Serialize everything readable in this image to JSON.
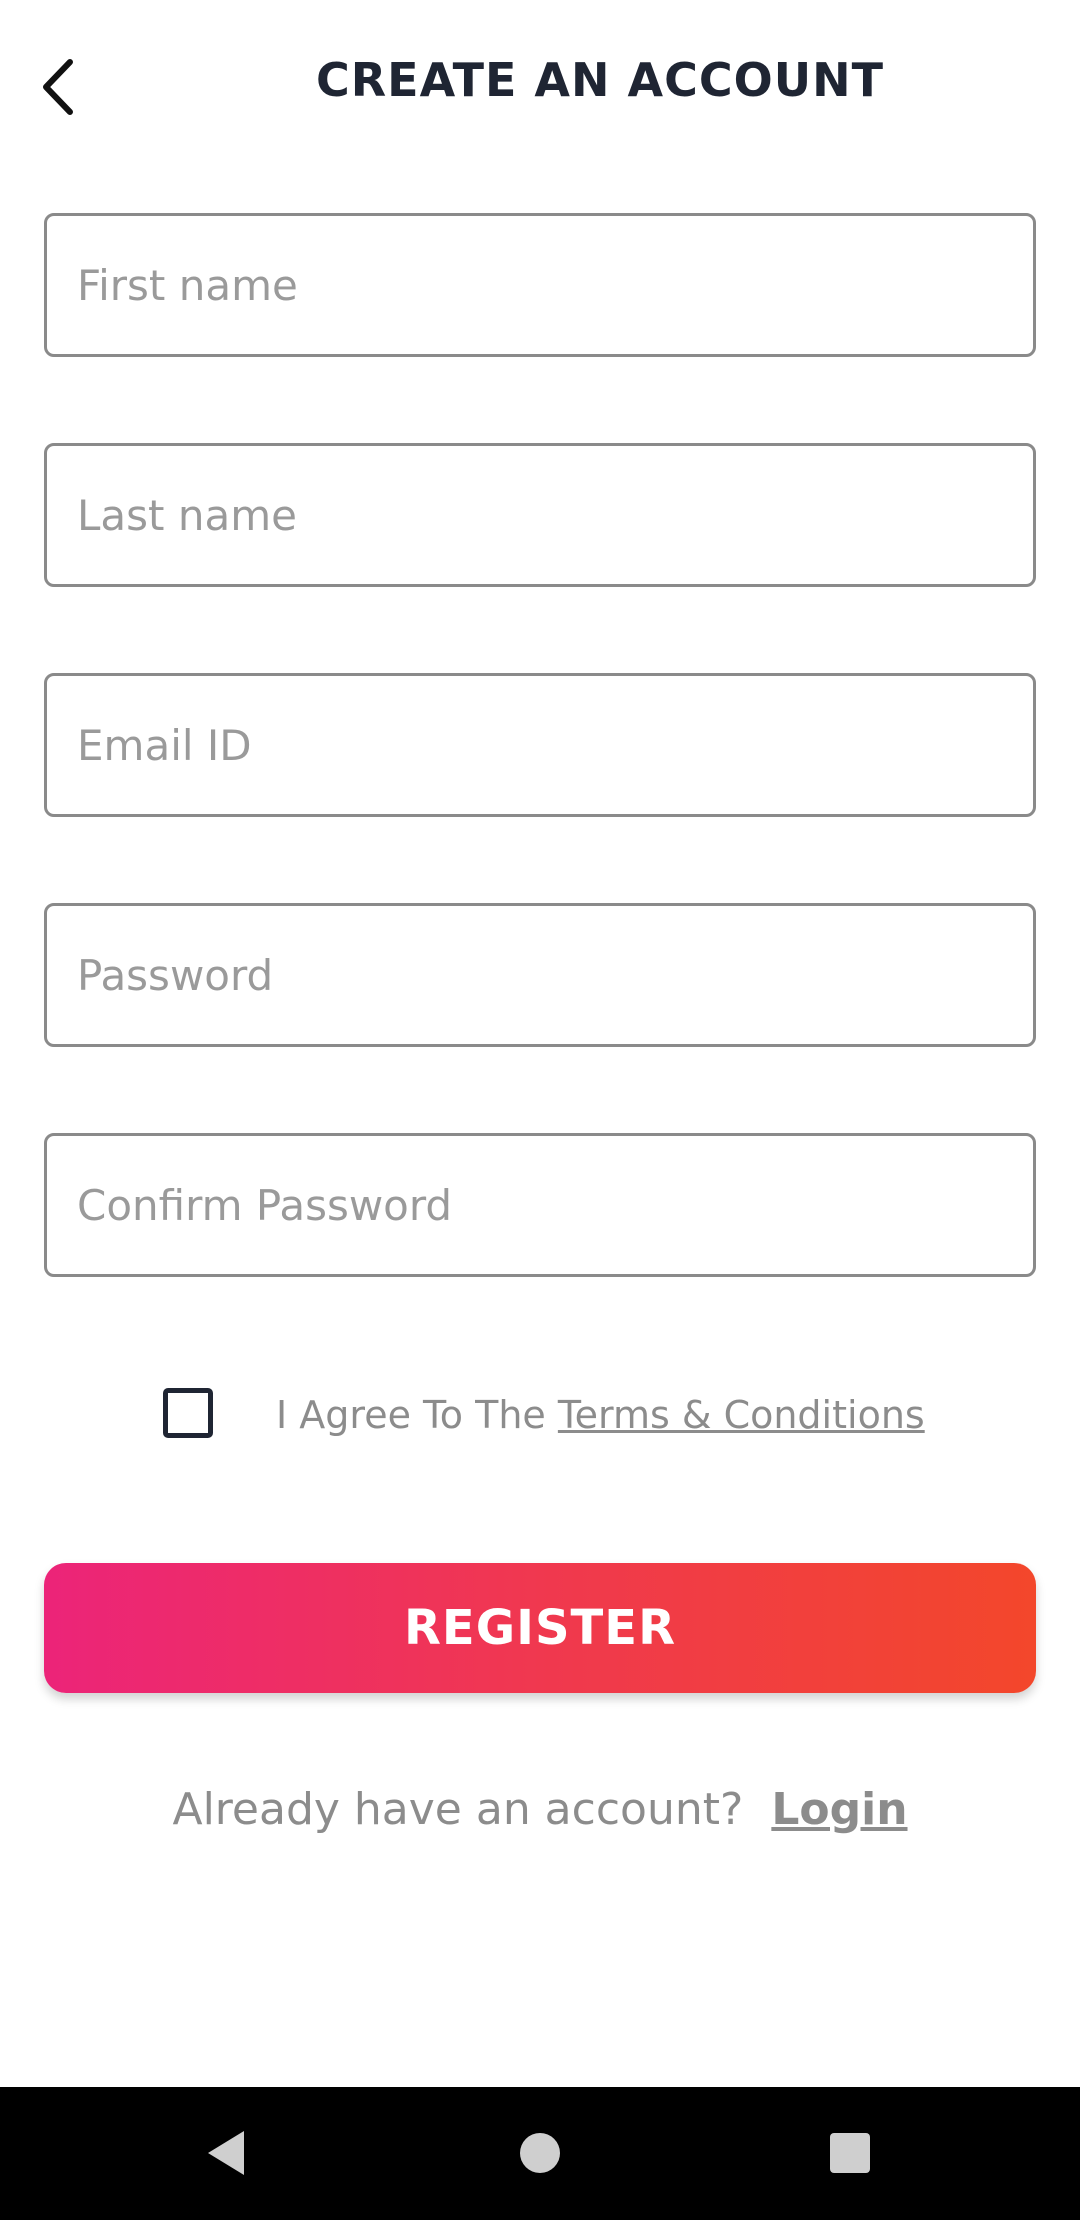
{
  "header": {
    "title": "CREATE AN ACCOUNT",
    "back_icon": "chevron-left-icon"
  },
  "form": {
    "first_name": {
      "placeholder": "First name",
      "value": ""
    },
    "last_name": {
      "placeholder": "Last name",
      "value": ""
    },
    "email": {
      "placeholder": "Email ID",
      "value": ""
    },
    "password": {
      "placeholder": "Password",
      "value": ""
    },
    "confirm_password": {
      "placeholder": "Confirm Password",
      "value": ""
    }
  },
  "agreement": {
    "checked": false,
    "text": "I Agree To The ",
    "link_label": "Terms & Conditions"
  },
  "register": {
    "label": "REGISTER",
    "gradient_start": "#ec2479",
    "gradient_end": "#f3472b"
  },
  "login_prompt": {
    "text": "Already have an account?",
    "link_label": "Login"
  },
  "system_nav": {
    "back_icon": "triangle-back-icon",
    "home_icon": "circle-home-icon",
    "recents_icon": "square-recents-icon"
  },
  "colors": {
    "title": "#1f2533",
    "muted_text": "#8c8c8c",
    "field_border": "#8a8a8a"
  }
}
